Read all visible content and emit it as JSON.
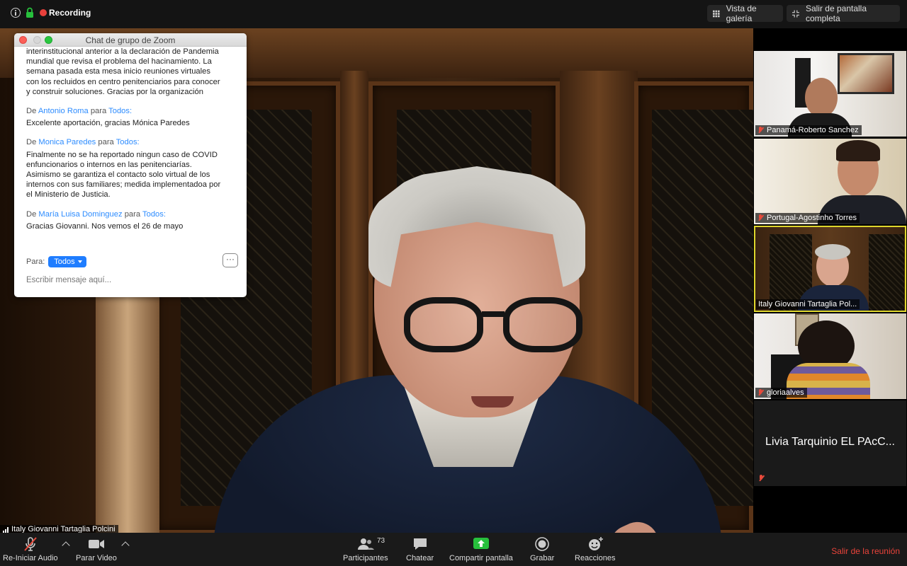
{
  "topbar": {
    "recording_label": "Recording",
    "gallery_view_label": "Vista de galería",
    "exit_fullscreen_label": "Salir de pantalla completa"
  },
  "main_video": {
    "speaker_name": "Italy Giovanni Tartaglia Polcini"
  },
  "chat": {
    "title": "Chat de grupo de Zoom",
    "first_message_text": "interinstitucional anterior a la declaración de Pandemia\nmundial que revisa el problema del hacinamiento. La\nsemana pasada esta mesa inicio reuniones virtuales\ncon los recluidos en centro penitenciarios para conocer\ny construir soluciones.  Gracias por la organización",
    "messages": [
      {
        "from_prefix": "De",
        "sender": "Antonio Roma",
        "to_prefix": "para",
        "recipient": "Todos:",
        "text": "Excelente aportación, gracias Mónica Paredes"
      },
      {
        "from_prefix": "De",
        "sender": "Monica Paredes",
        "to_prefix": "para",
        "recipient": "Todos:",
        "text": "Finalmente no se ha reportado ningun caso de COVID\nenfuncionarios o internos en las penitenciarías.\nAsimismo se garantiza el contacto solo virtual de los\ninternos con sus familiares; medida implementadoa por\nel Ministerio de Justicia."
      },
      {
        "from_prefix": "De",
        "sender": "María Luisa Dominguez",
        "to_prefix": "para",
        "recipient": "Todos:",
        "text": "Gracias Giovanni. Nos vemos el 26 de mayo"
      }
    ],
    "to_label": "Para:",
    "to_value": "Todos",
    "more_label": "···",
    "input_placeholder": "Escribir mensaje aquí..."
  },
  "participants": [
    {
      "name": "Panamá-Roberto Sanchez"
    },
    {
      "name": "Portugal-Agostinho Torres"
    },
    {
      "name": "Italy Giovanni Tartaglia Pol..."
    },
    {
      "name": "gloriaalves"
    },
    {
      "name": "Livia Tarquinio EL PAcC..."
    }
  ],
  "toolbar": {
    "unmute_label": "Re-Iniciar Audio",
    "stop_video_label": "Parar Video",
    "participants_label": "Participantes",
    "participants_count": "73",
    "chat_label": "Chatear",
    "share_label": "Compartir pantalla",
    "record_label": "Grabar",
    "reactions_label": "Reacciones",
    "leave_label": "Salir de la reunión"
  },
  "colors": {
    "accent_blue": "#2d8cff",
    "recording_red": "#e9403b",
    "share_green": "#27c03c",
    "leave_red": "#e8433a",
    "active_speaker": "#ded62d"
  }
}
